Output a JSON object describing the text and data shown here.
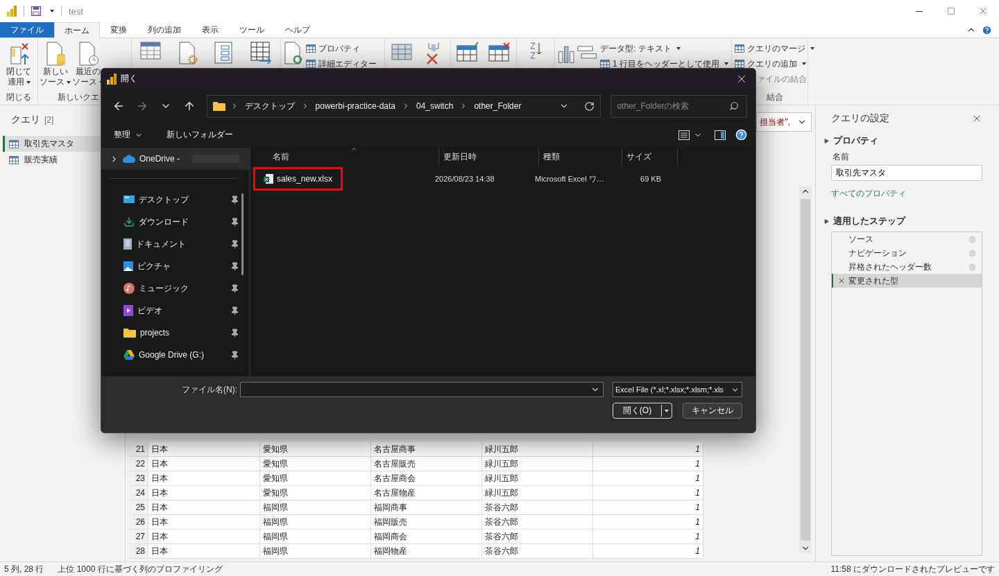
{
  "app": {
    "title": "test"
  },
  "ribbon_tabs": [
    {
      "label": "ファイル",
      "kind": "file",
      "selected": false
    },
    {
      "label": "ホーム",
      "kind": "tab",
      "selected": true
    },
    {
      "label": "変換",
      "kind": "tab",
      "selected": false
    },
    {
      "label": "列の追加",
      "kind": "tab",
      "selected": false
    },
    {
      "label": "表示",
      "kind": "tab",
      "selected": false
    },
    {
      "label": "ツール",
      "kind": "tab",
      "selected": false
    },
    {
      "label": "ヘルプ",
      "kind": "tab",
      "selected": false
    }
  ],
  "ribbon": {
    "close_apply": {
      "lines": [
        "閉じて",
        "適用"
      ],
      "dropdown": true
    },
    "close_group_label": "閉じる",
    "new_source": {
      "lines": [
        "新しい",
        "ソース"
      ],
      "dropdown": true
    },
    "recent_source": {
      "lines": [
        "最近の",
        "ソース"
      ],
      "dropdown": true
    },
    "new_query_group_label": "新しいクエ",
    "properties": "プロパティ",
    "advanced_editor": "詳細エディター",
    "data_type": {
      "label": "データ型: テキスト",
      "dropdown": true
    },
    "use_first_row": {
      "label": "1 行目をヘッダーとして使用",
      "dropdown": true
    },
    "merge_queries": {
      "label": "クエリのマージ",
      "dropdown": true
    },
    "append_queries": {
      "label": "クエリの追加",
      "dropdown": true
    },
    "combine_files": "ァイルの結合",
    "combine_group_label": "結合"
  },
  "queries": {
    "title": "クエリ",
    "count": "[2]",
    "items": [
      {
        "label": "取引先マスタ",
        "selected": true
      },
      {
        "label": "販売実績",
        "selected": false
      }
    ]
  },
  "formula": {
    "text": "担当者\","
  },
  "table": {
    "rows": [
      {
        "index": "21",
        "cells": [
          "日本",
          "愛知県",
          "名古屋商事",
          "緑川五郎",
          "1"
        ]
      },
      {
        "index": "22",
        "cells": [
          "日本",
          "愛知県",
          "名古屋販売",
          "緑川五郎",
          "1"
        ]
      },
      {
        "index": "23",
        "cells": [
          "日本",
          "愛知県",
          "名古屋商会",
          "緑川五郎",
          "1"
        ]
      },
      {
        "index": "24",
        "cells": [
          "日本",
          "愛知県",
          "名古屋物産",
          "緑川五郎",
          "1"
        ]
      },
      {
        "index": "25",
        "cells": [
          "日本",
          "福岡県",
          "福岡商事",
          "茶谷六郎",
          "1"
        ]
      },
      {
        "index": "26",
        "cells": [
          "日本",
          "福岡県",
          "福岡販売",
          "茶谷六郎",
          "1"
        ]
      },
      {
        "index": "27",
        "cells": [
          "日本",
          "福岡県",
          "福岡商会",
          "茶谷六郎",
          "1"
        ]
      },
      {
        "index": "28",
        "cells": [
          "日本",
          "福岡県",
          "福岡物産",
          "茶谷六郎",
          "1"
        ]
      }
    ]
  },
  "settings": {
    "title": "クエリの設定",
    "properties_heading": "プロパティ",
    "name_label": "名前",
    "name_value": "取引先マスタ",
    "all_properties": "すべてのプロパティ",
    "steps_heading": "適用したステップ",
    "steps": [
      {
        "label": "ソース",
        "kind": "settings",
        "selected": false
      },
      {
        "label": "ナビゲーション",
        "kind": "settings",
        "selected": false
      },
      {
        "label": "昇格されたヘッダー数",
        "kind": "settings",
        "selected": false
      },
      {
        "label": "変更された型",
        "kind": "plain",
        "selected": true
      }
    ]
  },
  "status_bar": {
    "left": "5 列, 28 行",
    "profiling": "上位 1000 行に基づく列のプロファイリング",
    "right": "11:58 にダウンロードされたプレビューです"
  },
  "dialog": {
    "title": "開く",
    "nav_buttons": [
      {
        "kind": "back",
        "disabled": false
      },
      {
        "kind": "forward",
        "disabled": true
      },
      {
        "kind": "recent",
        "disabled": false
      },
      {
        "kind": "up",
        "disabled": false
      }
    ],
    "breadcrumb": [
      "デスクトップ",
      "powerbi-practice-data",
      "04_switch",
      "other_Folder"
    ],
    "search": {
      "placeholder": "other_Folderの検索"
    },
    "toolbar": {
      "organize": "整理",
      "new_folder": "新しいフォルダー"
    },
    "nav_pane": [
      {
        "label": "OneDrive -",
        "kind": "cloud",
        "pinned": false
      },
      {
        "label": "デスクトップ",
        "kind": "desktop",
        "pinned": true
      },
      {
        "label": "ダウンロード",
        "kind": "download",
        "pinned": true
      },
      {
        "label": "ドキュメント",
        "kind": "document",
        "pinned": true
      },
      {
        "label": "ピクチャ",
        "kind": "picture",
        "pinned": true
      },
      {
        "label": "ミュージック",
        "kind": "music",
        "pinned": true
      },
      {
        "label": "ビデオ",
        "kind": "video",
        "pinned": true
      },
      {
        "label": "projects",
        "kind": "folder",
        "pinned": true
      },
      {
        "label": "Google Drive (G:)",
        "kind": "drive",
        "pinned": true
      }
    ],
    "columns": [
      {
        "label": "名前",
        "sorted": true
      },
      {
        "label": "更新日時",
        "sorted": false
      },
      {
        "label": "種類",
        "sorted": false
      },
      {
        "label": "サイズ",
        "sorted": false
      }
    ],
    "files": [
      {
        "name": "sales_new.xlsx",
        "modified": "2026/08/23 14:38",
        "type": "Microsoft Excel ワ…",
        "size": "69 KB",
        "highlighted": true
      }
    ],
    "filename_label": "ファイル名(N):",
    "filter": "Excel File (*.xl;*.xlsx;*.xlsm;*.xls",
    "open_button": "開く(O)",
    "cancel_button": "キャンセル"
  }
}
